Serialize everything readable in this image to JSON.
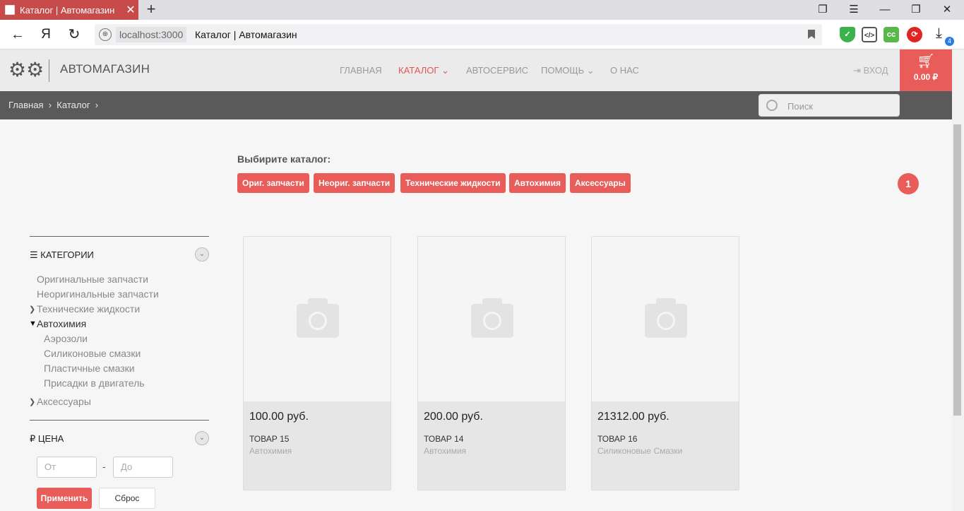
{
  "browser": {
    "tab_title": "Каталог | Автомагазин",
    "tab_close": "✕",
    "new_tab": "+",
    "host": "localhost:3000",
    "page_title": "Каталог | Автомагазин",
    "yandex_button": "Я",
    "download_count": "4"
  },
  "header": {
    "brand": "АВТОМАГАЗИН",
    "nav": [
      "ГЛАВНАЯ",
      "КАТАЛОГ",
      "АВТОСЕРВИС",
      "ПОМОЩЬ",
      "О НАС"
    ],
    "login": "ВХОД",
    "cart_total": "0.00 ₽"
  },
  "breadcrumb": {
    "items": [
      "Главная",
      "Каталог"
    ]
  },
  "search": {
    "placeholder": "Поиск"
  },
  "catalog": {
    "heading": "Выбирите каталог:",
    "buttons": [
      "Ориг. запчасти",
      "Неориг. запчасти",
      "Технические жидкости",
      "Автохимия",
      "Аксессуары"
    ],
    "page": "1"
  },
  "sidebar": {
    "categories_title": "КАТЕГОРИИ",
    "categories": [
      "Оригинальные запчасти",
      "Неоригинальные запчасти",
      "Технические жидкости",
      "Автохимия",
      "Аксессуары"
    ],
    "subcategories": [
      "Аэрозоли",
      "Силиконовые смазки",
      "Пластичные смазки",
      "Присадки в двигатель"
    ],
    "price_title": "ЦЕНА",
    "price_symbol": "₽",
    "price_from_placeholder": "От",
    "price_to_placeholder": "До",
    "price_dash": "-",
    "apply_label": "Применить",
    "reset_label": "Сброс"
  },
  "products": [
    {
      "price": "100.00 руб.",
      "name": "ТОВАР 15",
      "category": "Автохимия"
    },
    {
      "price": "200.00 руб.",
      "name": "ТОВАР 14",
      "category": "Автохимия"
    },
    {
      "price": "21312.00 руб.",
      "name": "ТОВАР 16",
      "category": "Силиконовые Смазки"
    }
  ],
  "colors": {
    "accent": "#e85d5a",
    "tab_active": "#c74b4b",
    "breadcrumb_bar": "#5a5a5a"
  }
}
